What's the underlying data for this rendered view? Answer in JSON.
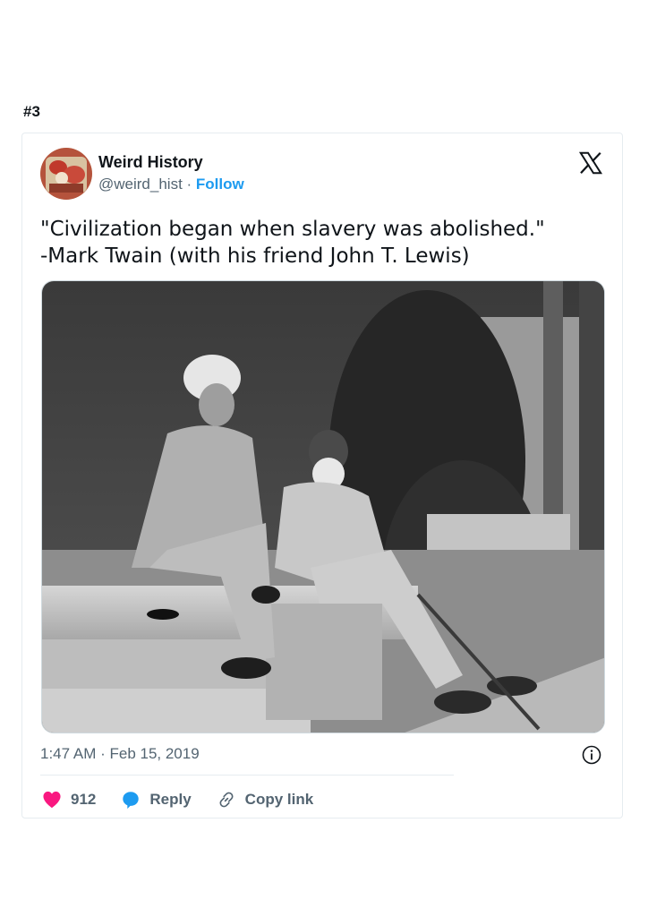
{
  "post_number": "#3",
  "tweet": {
    "author_name": "Weird History",
    "handle": "@weird_hist",
    "separator": " · ",
    "follow_label": "Follow",
    "text_lines": [
      "\"Civilization began when slavery was abolished.\"",
      "-Mark Twain (with his friend John T. Lewis)"
    ],
    "timestamp": "1:47 AM · Feb 15, 2019",
    "likes": "912",
    "reply_label": "Reply",
    "copy_link_label": "Copy link"
  },
  "colors": {
    "link_blue": "#1d9bf0",
    "heart_pink": "#f91880",
    "muted_text": "#536471"
  },
  "icons": [
    "x-logo-icon",
    "info-icon",
    "heart-icon",
    "reply-bubble-icon",
    "link-icon"
  ]
}
